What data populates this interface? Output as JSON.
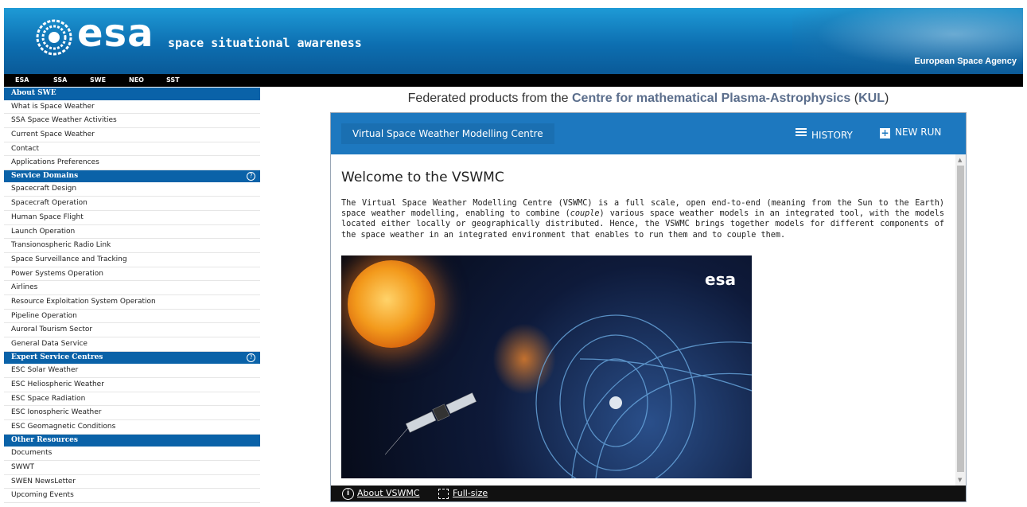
{
  "header": {
    "logo_text": "esa",
    "tagline": "space situational awareness",
    "agency": "European Space Agency"
  },
  "topnav": [
    "ESA",
    "SSA",
    "SWE",
    "NEO",
    "SST"
  ],
  "sidebar": {
    "sections": [
      {
        "title": "About SWE",
        "help": false,
        "items": [
          "What is Space Weather",
          "SSA Space Weather Activities",
          "Current Space Weather",
          "Contact",
          "Applications Preferences"
        ]
      },
      {
        "title": "Service Domains",
        "help": true,
        "items": [
          "Spacecraft Design",
          "Spacecraft Operation",
          "Human Space Flight",
          "Launch Operation",
          "Transionospheric Radio Link",
          "Space Surveillance and Tracking",
          "Power Systems Operation",
          "Airlines",
          "Resource Exploitation System Operation",
          "Pipeline Operation",
          "Auroral Tourism Sector",
          "General Data Service"
        ]
      },
      {
        "title": "Expert Service Centres",
        "help": true,
        "items": [
          "ESC Solar Weather",
          "ESC Heliospheric Weather",
          "ESC Space Radiation",
          "ESC Ionospheric Weather",
          "ESC Geomagnetic Conditions"
        ]
      },
      {
        "title": "Other Resources",
        "help": false,
        "items": [
          "Documents",
          "SWWT",
          "SWEN NewsLetter",
          "Upcoming Events"
        ]
      }
    ],
    "help_glyph": "?"
  },
  "main": {
    "federated_prefix": "Federated products from the ",
    "federated_link": "Centre for mathematical Plasma-Astrophysics",
    "federated_mid": " (",
    "federated_abbr": "KUL",
    "federated_suffix": ")",
    "panel": {
      "app_title": "Virtual Space Weather Modelling Centre",
      "history_label": "HISTORY",
      "new_run_label": "NEW RUN",
      "welcome_title": "Welcome to the VSWMC",
      "intro_part1": "The Virtual Space Weather Modelling Centre (VSWMC) is a full scale, open end-to-end (meaning from the Sun to the Earth) space weather modelling, enabling to combine (",
      "intro_em": "couple",
      "intro_part2": ") various space weather models in an integrated tool, with the models located either locally or geographically distributed. Hence, the VSWMC brings together models for different components of the space weather in an integrated environment that enables to run them and to couple them.",
      "hero_logo": "esa",
      "about_link": "About VSWMC",
      "fullsize_link": "Full-size"
    }
  },
  "icons": {
    "history": "list-icon",
    "new_run": "plus-box-icon",
    "about": "info-circle-icon",
    "fullsize": "fullscreen-icon"
  },
  "colors": {
    "section_bg": "#0a62a8",
    "panel_header": "#1d78bf",
    "federated_link": "#5b6e8c"
  }
}
